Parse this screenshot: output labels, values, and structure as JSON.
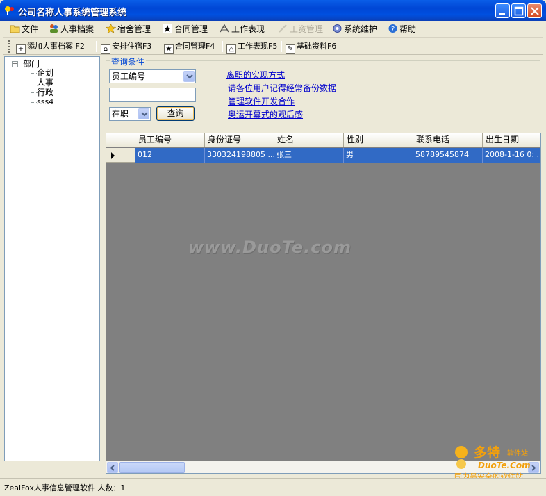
{
  "window": {
    "title": "公司名称人事系统管理系统"
  },
  "menu": [
    {
      "label": "文件",
      "icon": "folder-icon",
      "enabled": true
    },
    {
      "label": "人事档案",
      "icon": "users-icon",
      "enabled": true
    },
    {
      "label": "宿舍管理",
      "icon": "star-icon",
      "enabled": true
    },
    {
      "label": "合同管理",
      "icon": "contract-icon",
      "enabled": true
    },
    {
      "label": "工作表现",
      "icon": "performance-icon",
      "enabled": true
    },
    {
      "label": "工资管理",
      "icon": "salary-icon",
      "enabled": false
    },
    {
      "label": "系统维护",
      "icon": "gear-icon",
      "enabled": true
    },
    {
      "label": "帮助",
      "icon": "help-icon",
      "enabled": true
    }
  ],
  "toolbar": [
    {
      "label": "添加人事档案 F2",
      "icon": "add-icon"
    },
    {
      "label": "安排住宿F3",
      "icon": "home-icon"
    },
    {
      "label": "合同管理F4",
      "icon": "contract-icon"
    },
    {
      "label": "工作表现F5",
      "icon": "performance-icon"
    },
    {
      "label": "基础资料F6",
      "icon": "edit-icon"
    }
  ],
  "tree": {
    "root": "部门",
    "children": [
      "企划",
      "人事",
      "行政",
      "sss4"
    ]
  },
  "query": {
    "caption": "查询条件",
    "field_select": "员工编号",
    "keyword_value": "",
    "status_select": "在职",
    "search_label": "查询"
  },
  "links": [
    "离职的实现方式",
    "请各位用户记得经常备份数据",
    "管理软件开发合作",
    "奥运开幕式的观后感"
  ],
  "grid": {
    "columns": [
      "员工编号",
      "身份证号",
      "姓名",
      "性别",
      "联系电话",
      "出生日期"
    ],
    "rows": [
      [
        "012",
        "330324198805 ...",
        "张三",
        "男",
        "58789545874",
        "2008-1-16 0: ..."
      ]
    ]
  },
  "watermark": "www.DuoTe.com",
  "brand": {
    "name": "多特",
    "suffix": "软件站",
    "site": "DuoTe.Com",
    "slogan": "国内最安全的软件站"
  },
  "status": {
    "text": "ZealFox人事信息管理软件 人数：1"
  },
  "colors": {
    "titlebar": "#0050e0",
    "selection": "#316ac5",
    "link": "#0000cc",
    "grid_bg": "#808080"
  }
}
